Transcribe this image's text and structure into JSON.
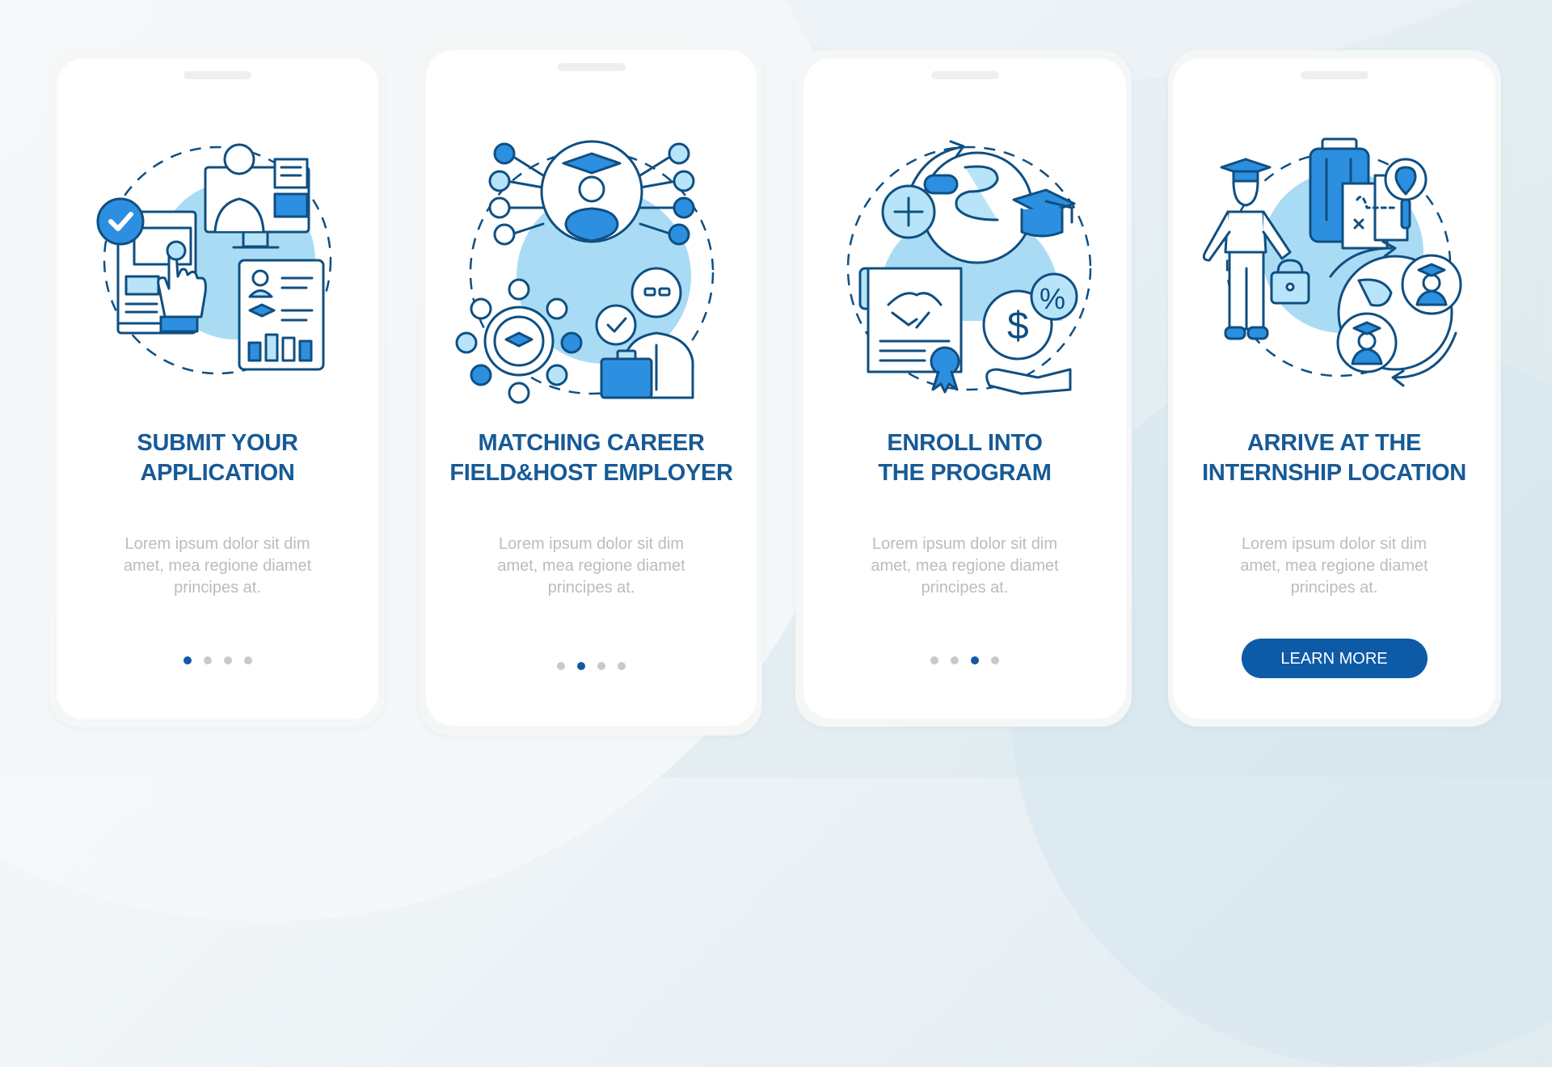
{
  "theme": {
    "accent": "#0d5aa7",
    "title_color": "#175a96",
    "body_color": "#bcbcbc",
    "dot_inactive": "#c9c9c9",
    "illustration_stroke": "#0f4f82",
    "illustration_light": "#a9dcf4",
    "illustration_mid": "#2d8fdf"
  },
  "screens": [
    {
      "illustration": "application-submission-icon",
      "title_lines": [
        "SUBMIT YOUR",
        "APPLICATION"
      ],
      "body_lines": [
        "Lorem ipsum dolor sit dim",
        "amet, mea regione diamet",
        "principes at."
      ],
      "page_index": 1,
      "page_count": 4
    },
    {
      "illustration": "career-matching-icon",
      "title_lines": [
        "MATCHING CAREER",
        "FIELD&HOST EMPLOYER"
      ],
      "body_lines": [
        "Lorem ipsum dolor sit dim",
        "amet, mea regione diamet",
        "principes at."
      ],
      "page_index": 2,
      "page_count": 4
    },
    {
      "illustration": "program-enrollment-icon",
      "title_lines": [
        "ENROLL INTO",
        "THE PROGRAM"
      ],
      "body_lines": [
        "Lorem ipsum dolor sit dim",
        "amet, mea regione diamet",
        "principes at."
      ],
      "page_index": 3,
      "page_count": 4
    },
    {
      "illustration": "internship-arrival-icon",
      "title_lines": [
        "ARRIVE AT THE",
        "INTERNSHIP LOCATION"
      ],
      "body_lines": [
        "Lorem ipsum dolor sit dim",
        "amet, mea regione diamet",
        "principes at."
      ],
      "button_label": "LEARN MORE"
    }
  ]
}
